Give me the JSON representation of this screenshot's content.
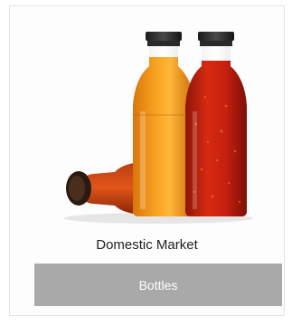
{
  "card": {
    "title": "Domestic Market",
    "button_label": "Bottles"
  },
  "image": {
    "subject": "sauce-bottles-icon"
  },
  "colors": {
    "button_bg": "#a9a9a9",
    "button_text": "#ffffff",
    "title_text": "#1f1f1f"
  }
}
